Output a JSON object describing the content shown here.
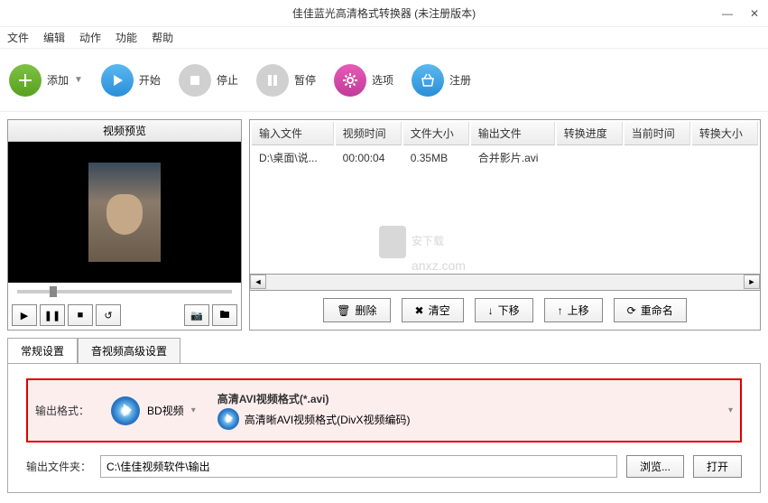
{
  "window": {
    "title": "佳佳蓝光高清格式转换器   (未注册版本)",
    "minimize": "—",
    "close": "✕"
  },
  "menu": {
    "file": "文件",
    "edit": "编辑",
    "action": "动作",
    "function": "功能",
    "help": "帮助"
  },
  "toolbar": {
    "add": "添加",
    "start": "开始",
    "stop": "停止",
    "pause": "暂停",
    "options": "选项",
    "register": "注册"
  },
  "preview": {
    "title": "视频预览"
  },
  "table": {
    "headers": {
      "input": "输入文件",
      "duration": "视频时间",
      "size": "文件大小",
      "output": "输出文件",
      "progress": "转换进度",
      "current": "当前时间",
      "convsize": "转换大小"
    },
    "rows": [
      {
        "input": "D:\\桌面\\说...",
        "duration": "00:00:04",
        "size": "0.35MB",
        "output": "合并影片.avi",
        "progress": "",
        "current": "",
        "convsize": ""
      }
    ]
  },
  "actions": {
    "delete": "删除",
    "clear": "清空",
    "down": "下移",
    "up": "上移",
    "rename": "重命名"
  },
  "tabs": {
    "general": "常规设置",
    "advanced": "音视频高级设置"
  },
  "output": {
    "format_label": "输出格式：",
    "category": "BD视频",
    "format_title": "高清AVI视频格式(*.avi)",
    "format_desc": "高清晰AVI视频格式(DivX视频编码)",
    "folder_label": "输出文件夹：",
    "folder_path": "C:\\佳佳视频软件\\输出",
    "browse": "浏览...",
    "open": "打开"
  },
  "watermark": {
    "main": "安下载",
    "sub": "anxz.com"
  }
}
